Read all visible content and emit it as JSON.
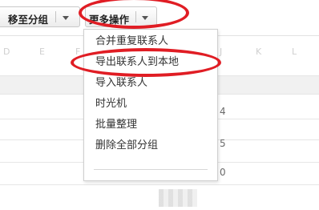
{
  "toolbar": {
    "move_to_group": "移至分组",
    "more_actions": "更多操作"
  },
  "sheet": {
    "column_letters": [
      "D",
      "E",
      "F",
      "G",
      "H",
      "I",
      "J",
      "K",
      "L"
    ],
    "cell_digits": [
      "4",
      "5",
      "0"
    ]
  },
  "menu": {
    "items": [
      {
        "label": "合并重复联系人"
      },
      {
        "label": "导出联系人到本地"
      },
      {
        "label": "导入联系人"
      },
      {
        "label": "时光机"
      },
      {
        "label": "批量整理"
      },
      {
        "label": "删除全部分组"
      }
    ]
  },
  "colors": {
    "highlight": "#e01d24",
    "menu_border": "#cfcfcf",
    "toolbar_button": "#ececec"
  }
}
